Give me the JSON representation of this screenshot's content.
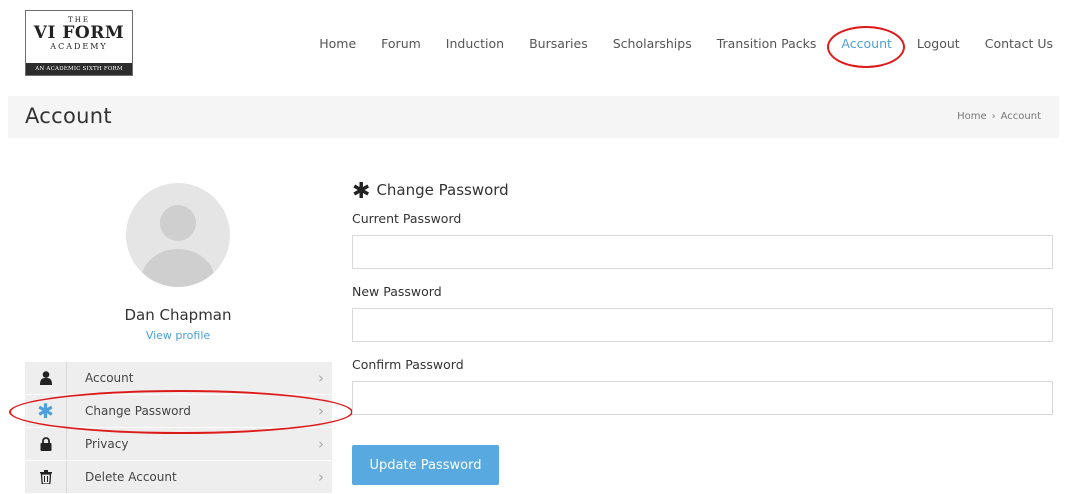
{
  "logo": {
    "line1": "THE",
    "line2": "VI FORM",
    "line3": "ACADEMY",
    "strip": "AN ACADEMIC SIXTH FORM"
  },
  "nav": {
    "items": [
      "Home",
      "Forum",
      "Induction",
      "Bursaries",
      "Scholarships",
      "Transition Packs",
      "Account",
      "Logout",
      "Contact Us"
    ],
    "active": "Account"
  },
  "page": {
    "title": "Account",
    "breadcrumb": {
      "home": "Home",
      "sep": "›",
      "current": "Account"
    }
  },
  "profile": {
    "name": "Dan Chapman",
    "view_profile": "View profile"
  },
  "sidebar": {
    "items": [
      {
        "label": "Account",
        "icon": "user-icon"
      },
      {
        "label": "Change Password",
        "icon": "asterisk-icon"
      },
      {
        "label": "Privacy",
        "icon": "lock-icon"
      },
      {
        "label": "Delete Account",
        "icon": "trash-icon"
      }
    ],
    "selected": "Change Password"
  },
  "form": {
    "title": "Change Password",
    "current_label": "Current Password",
    "current_value": "",
    "new_label": "New Password",
    "new_value": "",
    "confirm_label": "Confirm Password",
    "confirm_value": "",
    "submit_label": "Update Password"
  },
  "colors": {
    "accent": "#4c9fd9",
    "button": "#58a9e0",
    "annotation": "#dd1a1a"
  }
}
